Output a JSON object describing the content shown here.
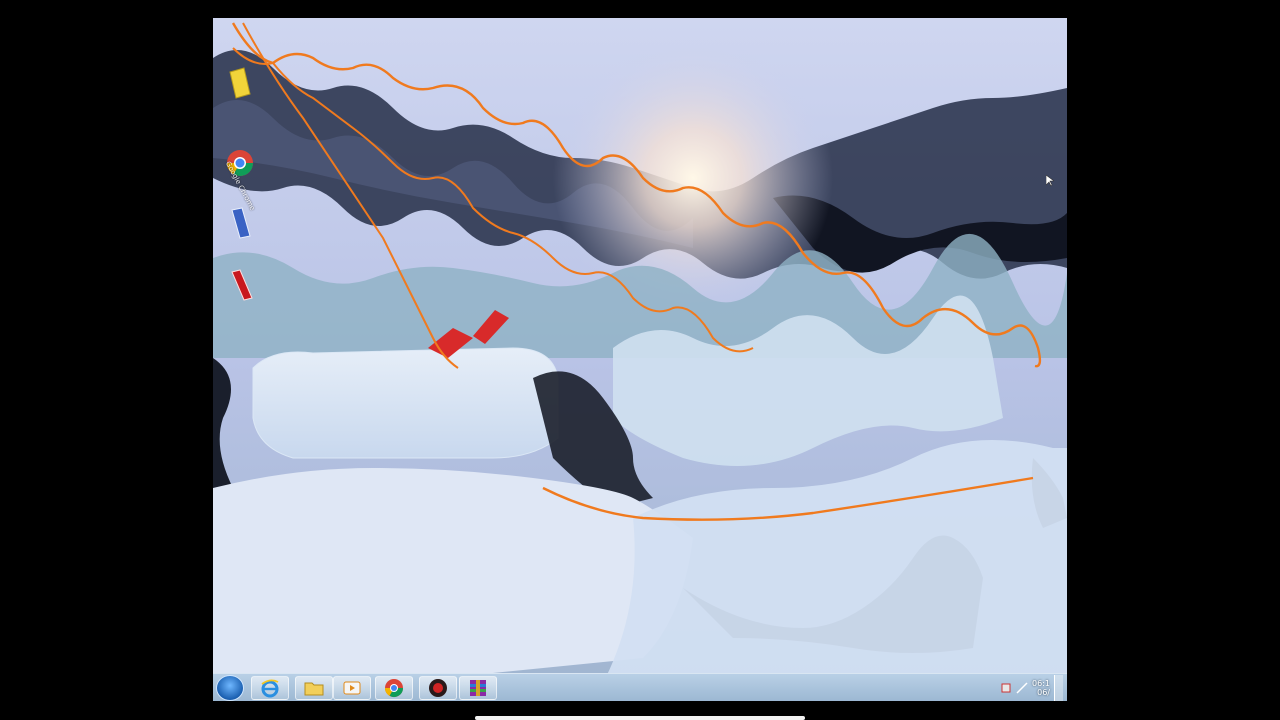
{
  "desktop": {
    "icons": [
      {
        "name": "folder-icon",
        "label": ""
      },
      {
        "name": "chrome-icon",
        "label": "Google Chrome"
      },
      {
        "name": "media-icon",
        "label": ""
      },
      {
        "name": "app-icon",
        "label": ""
      }
    ]
  },
  "taskbar": {
    "pinned": [
      {
        "name": "internet-explorer-icon"
      },
      {
        "name": "explorer-folder-icon"
      },
      {
        "name": "media-player-icon"
      },
      {
        "name": "chrome-icon"
      },
      {
        "name": "record-icon"
      },
      {
        "name": "winrar-icon"
      }
    ],
    "clock_time": "06:1",
    "clock_date": "06/"
  },
  "colors": {
    "annotation_stroke": "#f07a1e",
    "taskbar_top": "#b9d0e6",
    "taskbar_bottom": "#9bb7d2"
  }
}
